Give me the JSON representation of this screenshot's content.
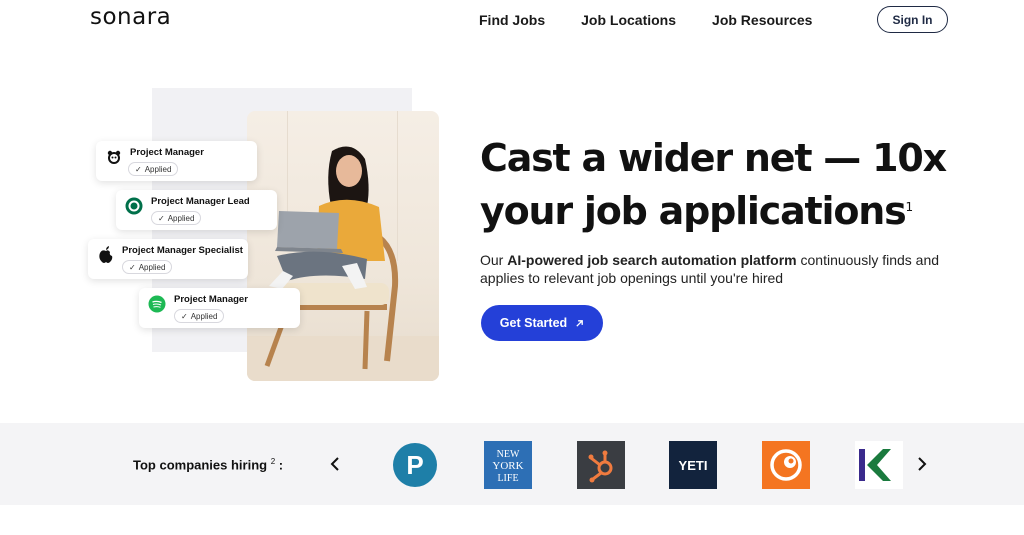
{
  "brand": {
    "logo_text": "sonara"
  },
  "nav": {
    "links": [
      "Find Jobs",
      "Job Locations",
      "Job Resources"
    ],
    "signin_label": "Sign In"
  },
  "hero": {
    "headline_line1": "Cast a wider net — 10x",
    "headline_line2": "your job applications",
    "headline_footnote": "1",
    "sub_prefix": "Our ",
    "sub_bold": "AI-powered job search automation platform",
    "sub_suffix": " continuously finds and applies to relevant job openings until you're hired",
    "cta_label": "Get Started",
    "accent_color": "#2440d8"
  },
  "applications": [
    {
      "title": "Project Manager",
      "status": "Applied",
      "company_icon": "panda-icon"
    },
    {
      "title": "Project Manager Lead",
      "status": "Applied",
      "company_icon": "starbucks-icon"
    },
    {
      "title": "Project Manager Specialist",
      "status": "Applied",
      "company_icon": "apple-icon"
    },
    {
      "title": "Project Manager",
      "status": "Applied",
      "company_icon": "spotify-icon"
    }
  ],
  "companies": {
    "label": "Top companies hiring",
    "footnote": "2",
    "label_suffix": " :",
    "logos": [
      {
        "icon": "pearson-logo",
        "text": "P",
        "color": "#1e7fa8"
      },
      {
        "icon": "newyorklife-logo",
        "text": "NEW YORK LIFE",
        "color": "#2d6fb5"
      },
      {
        "icon": "hubspot-logo",
        "text": "",
        "color": "#f07b3f"
      },
      {
        "icon": "yeti-logo",
        "text": "YETI",
        "color": "#12233d"
      },
      {
        "icon": "crunchyroll-logo",
        "text": "",
        "color": "#f47521"
      },
      {
        "icon": "klaviyo-logo",
        "text": "K",
        "color": "#1a7a3e"
      }
    ]
  }
}
